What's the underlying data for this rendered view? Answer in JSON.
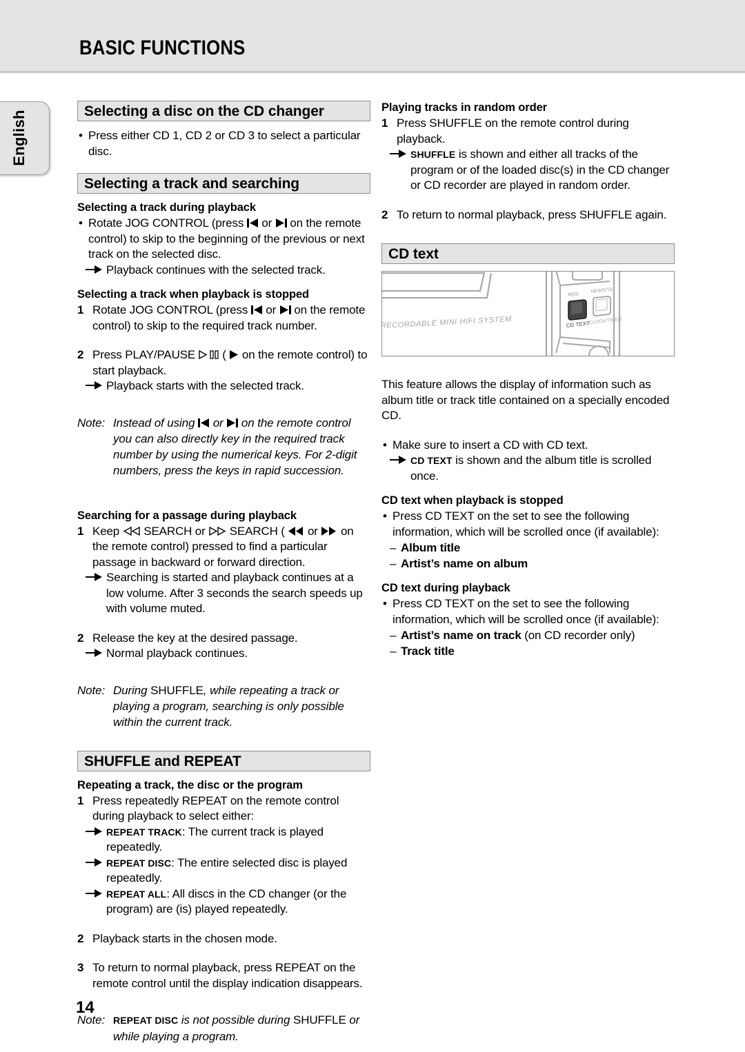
{
  "header": {
    "title": "BASIC FUNCTIONS"
  },
  "language_tab": {
    "label": "English"
  },
  "page_number": "14",
  "left_column": {
    "section_disc": {
      "heading": "Selecting a disc on the CD changer",
      "bullet": "Press either CD 1, CD 2 or CD 3 to select a particular disc."
    },
    "section_track": {
      "heading": "Selecting a track and searching",
      "sub_during_playback": {
        "heading": "Selecting a track during playback",
        "bullet_a": "Rotate JOG CONTROL (press",
        "bullet_or": "or",
        "bullet_b": "on the remote control) to skip to the beginning of the previous or next track on the selected disc.",
        "result": "Playback continues with the selected track."
      },
      "sub_stopped": {
        "heading": "Selecting a track when playback is stopped",
        "step1_num": "1",
        "step1_a": "Rotate JOG CONTROL (press",
        "step1_or": "or",
        "step1_b": "on the remote control) to skip to the required track number.",
        "step2_num": "2",
        "step2_a": "Press PLAY/PAUSE",
        "step2_b": "(",
        "step2_c": "on the remote control) to start playback.",
        "step2_result": "Playback starts with the selected track."
      },
      "note": {
        "label": "Note:",
        "a": "Instead of using",
        "or": "or",
        "b": "on the remote control you can also directly key in the required track number by using the numerical keys. For 2-digit numbers, press the keys in rapid succession."
      },
      "sub_search": {
        "heading": "Searching for a passage during playback",
        "step1_num": "1",
        "step1_a": "Keep",
        "step1_b": "SEARCH or",
        "step1_c": "SEARCH (",
        "step1_or": "or",
        "step1_d": "on the remote control) pressed to find a particular passage in backward or forward direction.",
        "step1_result": "Searching is started and playback continues at a low volume. After 3 seconds the search speeds up with volume muted.",
        "step2_num": "2",
        "step2": "Release the key at the desired passage.",
        "step2_result": "Normal playback continues."
      },
      "note2": {
        "label": "Note:",
        "a": "During",
        "upright": "SHUFFLE",
        "b": ", while repeating a track or playing a program, searching is only possible within the current track."
      }
    },
    "section_shuffle_repeat": {
      "heading": "SHUFFLE and REPEAT",
      "sub_repeating": {
        "heading": "Repeating a track, the disc or the program",
        "step1_num": "1",
        "step1": "Press repeatedly REPEAT on the remote control during playback to select either:",
        "result1_ind": "REPEAT TRACK",
        "result1_text": ": The current track is played repeatedly.",
        "result2_ind": "REPEAT DISC",
        "result2_text": ": The entire selected disc is played repeatedly.",
        "result3_ind": "REPEAT ALL",
        "result3_text": ": All discs in the CD changer (or the program) are (is) played repeatedly.",
        "step2_num": "2",
        "step2": "Playback starts in the chosen mode.",
        "step3_num": "3",
        "step3": "To return to normal playback, press REPEAT on the remote control until the display indication disappears."
      },
      "note": {
        "label": "Note:",
        "ind": "REPEAT DISC",
        "a": "is not possible during",
        "upright": "SHUFFLE",
        "b": "or while playing a program."
      }
    }
  },
  "right_column": {
    "section_random": {
      "heading": "Playing tracks in random order",
      "step1_num": "1",
      "step1": "Press SHUFFLE on the remote control during playback.",
      "step1_result_ind": "SHUFFLE",
      "step1_result_text": "is shown and either all tracks of the program or of the loaded disc(s) in the CD changer or CD recorder are played in random order.",
      "step2_num": "2",
      "step2": "To return to normal playback, press SHUFFLE again."
    },
    "section_cdtext": {
      "heading": "CD text",
      "illustration": {
        "system_label": "RECORDABLE MINI HIFI SYSTEM",
        "button_top_label": "RDS",
        "button_bottom_label": "CD TEXT",
        "button2_top_label": "NEWS/TA",
        "button2_bottom_label": "CLOCK/TIMER"
      },
      "intro": "This feature allows the display of information such as album title or track title contained on a specially encoded CD.",
      "bullet": "Make sure to insert a CD with CD text.",
      "bullet_result_ind": "CD TEXT",
      "bullet_result_text": "is shown and the album title is scrolled once.",
      "sub_stopped": {
        "heading": "CD text when playback is stopped",
        "bullet": "Press CD TEXT on the set to see the following information, which will be scrolled once (if available):",
        "item1": "Album title",
        "item2": "Artist’s name on album"
      },
      "sub_playback": {
        "heading": "CD text during playback",
        "bullet": "Press CD TEXT on the set to see the following information, which will be scrolled once (if available):",
        "item1_bold": "Artist’s name on track",
        "item1_rest": "(on CD recorder only)",
        "item2": "Track title"
      }
    }
  }
}
